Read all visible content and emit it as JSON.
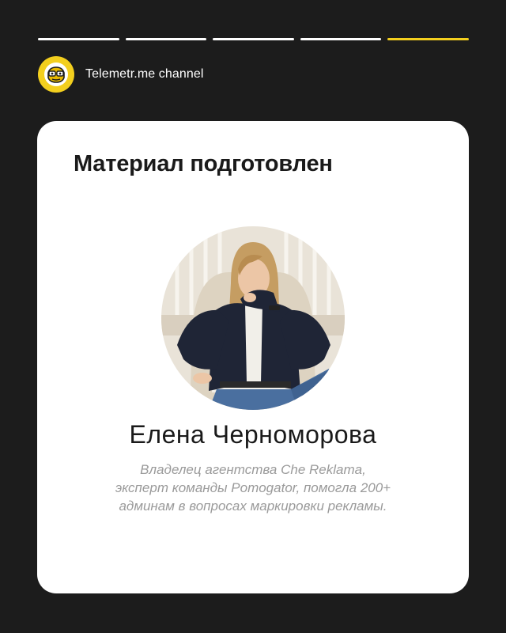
{
  "progress": {
    "segments": 5,
    "active_index": 4,
    "colors": {
      "inactive": "#ffffff",
      "active": "#f3cf1e"
    }
  },
  "header": {
    "logo_icon": "telemetr-logo-icon",
    "channel_name": "Telemetr.me channel"
  },
  "card": {
    "title": "Материал подготовлен",
    "avatar_icon": "author-photo",
    "person_name": "Елена Черноморова",
    "bio_lines": [
      "Владелец агентства Che Reklama,",
      "эксперт команды Pomogator, помогла 200+",
      "админам в вопросах маркировки рекламы."
    ]
  },
  "colors": {
    "background": "#1c1c1c",
    "card": "#ffffff",
    "accent": "#f3cf1e",
    "bio_text": "#9a9a9a"
  }
}
